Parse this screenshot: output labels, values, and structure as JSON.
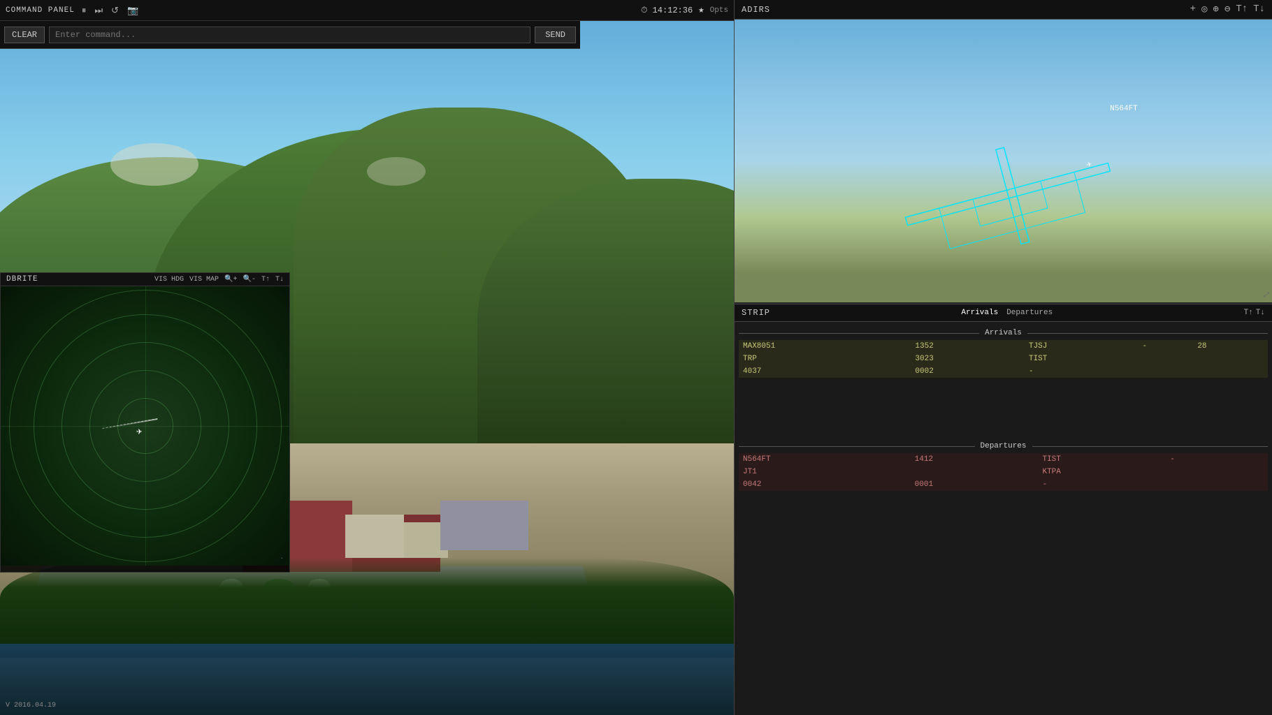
{
  "top_bar": {
    "title": "COMMAND PANEL",
    "pause_icon": "⏸",
    "forward_icon": "⏭",
    "refresh_icon": "↺",
    "camera_icon": "📷",
    "clock_icon": "⏱",
    "time": "14:12:36",
    "star_icon": "★",
    "options": "Opts"
  },
  "command_panel": {
    "clear_label": "CLEAR",
    "input_placeholder": "Enter command...",
    "send_label": "SEND"
  },
  "dbrite": {
    "title": "DBRITE",
    "vis_hdg": "VIS HDG",
    "vis_map": "VIS MAP",
    "zoom_in": "+",
    "zoom_out": "-",
    "font_up": "T↑",
    "font_down": "T↓",
    "coord": "·"
  },
  "adirs": {
    "title": "ADIRS",
    "aircraft_label": "N564FT",
    "controls": [
      "+",
      "◎",
      "⊕",
      "⊖",
      "T↑",
      "T↓"
    ]
  },
  "strip": {
    "title": "STRIP",
    "tabs": [
      "Arrivals",
      "Departures"
    ],
    "font_controls": [
      "T↑",
      "T↓"
    ],
    "arrivals_label": "Arrivals",
    "departures_label": "Departures",
    "arrivals": [
      {
        "callsign": "MAX8051",
        "time": "1352",
        "dest": "TJSJ",
        "route": "-",
        "extra": "28"
      },
      {
        "callsign": "TRP",
        "time": "3023",
        "dest": "TIST",
        "route": "",
        "extra": ""
      },
      {
        "callsign": "4037",
        "time": "0002",
        "dest": "-",
        "route": "",
        "extra": ""
      }
    ],
    "departures": [
      {
        "callsign": "N564FT",
        "time": "1412",
        "dest": "TIST",
        "route": "-",
        "extra": ""
      },
      {
        "callsign": "JT1",
        "time": "",
        "dest": "KTPA",
        "route": "",
        "extra": ""
      },
      {
        "callsign": "0042",
        "time": "0001",
        "dest": "-",
        "route": "",
        "extra": ""
      }
    ]
  },
  "version": "V 2016.04.19"
}
